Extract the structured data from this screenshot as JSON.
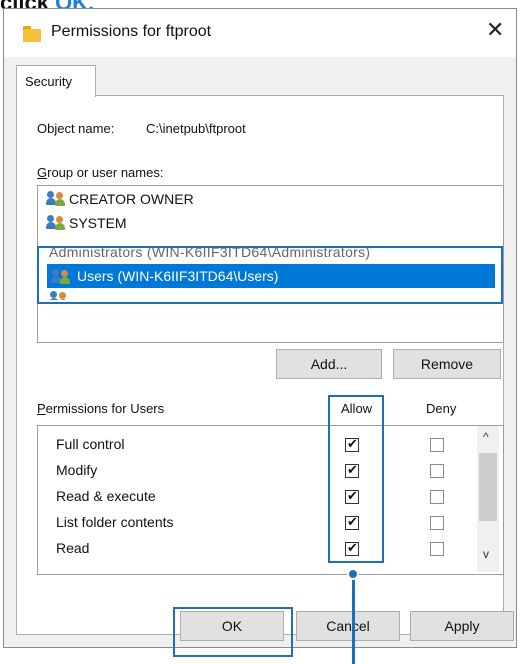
{
  "instruction": {
    "prefix": "click",
    "target": "OK."
  },
  "window": {
    "title": "Permissions for ftproot",
    "close_glyph": "✕"
  },
  "tab": {
    "label": "Security"
  },
  "object": {
    "label": "Object name:",
    "value": "C:\\inetpub\\ftproot"
  },
  "group_label": "Group or user names:",
  "users": [
    {
      "name": "CREATOR OWNER"
    },
    {
      "name": "SYSTEM"
    },
    {
      "name": "Administrators (WIN-K6IIF3ITD64\\Administrators)"
    },
    {
      "name": "Users (WIN-K6IIF3ITD64\\Users)",
      "selected": true
    }
  ],
  "buttons": {
    "add": "Add...",
    "remove": "Remove",
    "ok": "OK",
    "cancel": "Cancel",
    "apply": "Apply"
  },
  "permissions": {
    "header": "Permissions for Users",
    "allow_header": "Allow",
    "deny_header": "Deny",
    "rows": [
      {
        "name": "Full control",
        "allow": true,
        "deny": false
      },
      {
        "name": "Modify",
        "allow": true,
        "deny": false
      },
      {
        "name": "Read & execute",
        "allow": true,
        "deny": false
      },
      {
        "name": "List folder contents",
        "allow": true,
        "deny": false
      },
      {
        "name": "Read",
        "allow": true,
        "deny": false
      }
    ]
  },
  "scroll_arrows": {
    "up": "^",
    "down": "v"
  },
  "colors": {
    "accent": "#1e6fb8",
    "selection": "#0078d7",
    "instruction_accent": "#1e7fd8"
  }
}
